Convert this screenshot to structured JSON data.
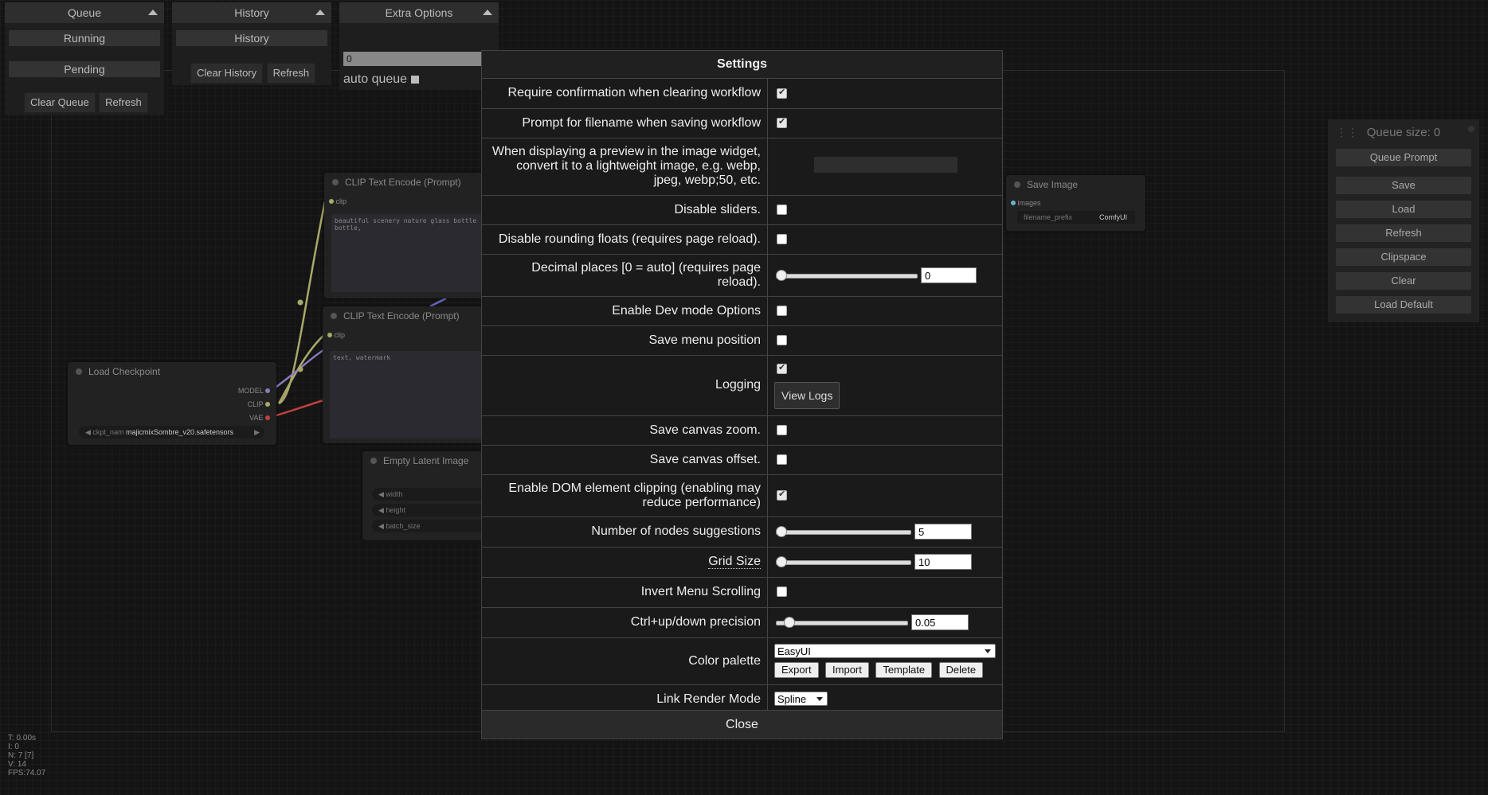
{
  "queue_panel": {
    "title": "Queue",
    "running": "Running",
    "pending": "Pending",
    "clear_queue": "Clear Queue",
    "refresh": "Refresh"
  },
  "history_panel": {
    "title": "History",
    "history_label": "History",
    "clear_history": "Clear History",
    "refresh": "Refresh"
  },
  "extra_options": {
    "title": "Extra Options",
    "batch_value": "0",
    "auto_queue": "auto queue"
  },
  "nodes": {
    "clip1": {
      "title": "CLIP Text Encode (Prompt)",
      "input": "clip",
      "text": "beautiful scenery nature glass bottle\nbottle,"
    },
    "clip2": {
      "title": "CLIP Text Encode (Prompt)",
      "input": "clip",
      "text": "text, watermark"
    },
    "checkpoint": {
      "title": "Load Checkpoint",
      "out_model": "MODEL",
      "out_clip": "CLIP",
      "out_vae": "VAE",
      "widget_name": "ckpt_nam",
      "widget_value": "majicmixSombre_v20.safetensors"
    },
    "latent": {
      "title": "Empty Latent Image",
      "w1": "width",
      "w2": "height",
      "w3": "batch_size"
    },
    "save": {
      "title": "Save Image",
      "input": "images",
      "prefix_label": "filename_prefix",
      "prefix_value": "ComfyUI"
    }
  },
  "sidebar": {
    "queue_size": "Queue size: 0",
    "buttons": [
      "Queue Prompt",
      "Save",
      "Load",
      "Refresh",
      "Clipspace",
      "Clear",
      "Load Default"
    ]
  },
  "settings": {
    "title": "Settings",
    "close": "Close",
    "rows": {
      "confirm_clear": "Require confirmation when clearing workflow",
      "prompt_filename": "Prompt for filename when saving workflow",
      "preview_format": "When displaying a preview in the image widget, convert it to a lightweight image, e.g. webp, jpeg, webp;50, etc.",
      "disable_sliders": "Disable sliders.",
      "disable_rounding": "Disable rounding floats (requires page reload).",
      "decimal_places": "Decimal places [0 = auto] (requires page reload).",
      "decimal_value": "0",
      "dev_mode": "Enable Dev mode Options",
      "save_menu_pos": "Save menu position",
      "logging": "Logging",
      "view_logs": "View Logs",
      "save_zoom": "Save canvas zoom.",
      "save_offset": "Save canvas offset.",
      "dom_clipping": "Enable DOM element clipping (enabling may reduce performance)",
      "node_suggestions": "Number of nodes suggestions",
      "node_suggestions_value": "5",
      "grid_size": "Grid Size",
      "grid_size_value": "10",
      "invert_scroll": "Invert Menu Scrolling",
      "ctrl_precision": "Ctrl+up/down precision",
      "ctrl_precision_value": "0.05",
      "color_palette": "Color palette",
      "palette_value": "EasyUI",
      "export": "Export",
      "import": "Import",
      "template": "Template",
      "delete": "Delete",
      "link_mode": "Link Render Mode",
      "link_mode_value": "Spline"
    }
  },
  "stats": {
    "t": "T: 0.00s",
    "i": "I: 0",
    "n": "N: 7 [7]",
    "v": "V: 14",
    "fps": "FPS:74.07"
  }
}
